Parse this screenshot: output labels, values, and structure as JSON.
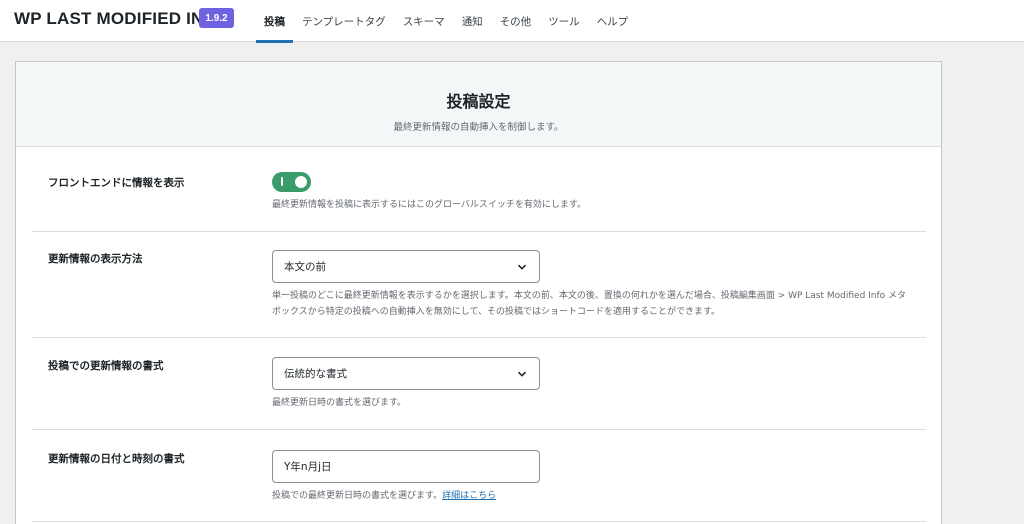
{
  "header": {
    "brand": "WP LAST MODIFIED INFO",
    "version": "1.9.2",
    "tabs": [
      {
        "label": "投稿",
        "active": true
      },
      {
        "label": "テンプレートタグ",
        "active": false
      },
      {
        "label": "スキーマ",
        "active": false
      },
      {
        "label": "通知",
        "active": false
      },
      {
        "label": "その他",
        "active": false
      },
      {
        "label": "ツール",
        "active": false
      },
      {
        "label": "ヘルプ",
        "active": false
      }
    ]
  },
  "card": {
    "title": "投稿設定",
    "subtitle": "最終更新情報の自動挿入を制御します。"
  },
  "settings": {
    "frontend": {
      "label": "フロントエンドに情報を表示",
      "toggle_on": true,
      "toggle_mark": "I",
      "description": "最終更新情報を投稿に表示するにはこのグローバルスイッチを有効にします。"
    },
    "display_method": {
      "label": "更新情報の表示方法",
      "value": "本文の前",
      "description": "単一投稿のどこに最終更新情報を表示するかを選択します。本文の前、本文の後、置換の何れかを選んだ場合、投稿編集画面 > WP Last Modified Info メタボックスから特定の投稿への自動挿入を無効にして、その投稿ではショートコードを適用することができます。"
    },
    "post_format": {
      "label": "投稿での更新情報の書式",
      "value": "伝統的な書式",
      "description": "最終更新日時の書式を選びます。"
    },
    "datetime_format": {
      "label": "更新情報の日付と時刻の書式",
      "value": "Y年n月j日",
      "description": "投稿での最終更新日時の書式を選びます。",
      "link_text": "詳細はこちら"
    }
  },
  "colors": {
    "accent": "#2271b1",
    "badge": "#6e62e0",
    "toggle_on": "#3a9c6a"
  }
}
